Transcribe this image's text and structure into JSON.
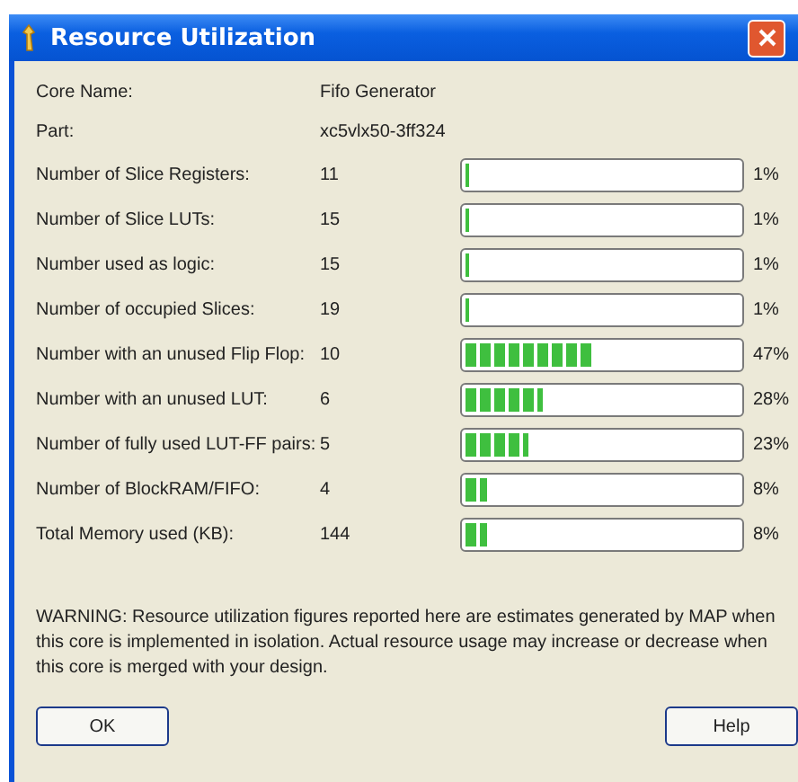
{
  "window": {
    "title": "Resource Utilization"
  },
  "info": [
    {
      "label": "Core Name:",
      "value": "Fifo Generator"
    },
    {
      "label": "Part:",
      "value": "xc5vlx50-3ff324"
    }
  ],
  "resources": [
    {
      "label": "Number of Slice Registers:",
      "value": "11",
      "level": 0.01,
      "percent": "1%"
    },
    {
      "label": "Number of Slice LUTs:",
      "value": "15",
      "level": 0.01,
      "percent": "1%"
    },
    {
      "label": "Number used as logic:",
      "value": "15",
      "level": 0.01,
      "percent": "1%"
    },
    {
      "label": "Number of occupied Slices:",
      "value": "19",
      "level": 0.01,
      "percent": "1%"
    },
    {
      "label": "Number with an unused Flip Flop:",
      "value": "10",
      "level": 0.47,
      "percent": "47%"
    },
    {
      "label": "Number with an unused LUT:",
      "value": "6",
      "level": 0.28,
      "percent": "28%"
    },
    {
      "label": "Number of fully used LUT-FF pairs:",
      "value": "5",
      "level": 0.23,
      "percent": "23%"
    },
    {
      "label": "Number of BlockRAM/FIFO:",
      "value": "4",
      "level": 0.08,
      "percent": "8%"
    },
    {
      "label": "Total Memory used (KB):",
      "value": "144",
      "level": 0.08,
      "percent": "8%"
    }
  ],
  "warning": "WARNING: Resource utilization figures reported here are estimates generated by MAP when this core is implemented in isolation.  Actual resource usage may increase or decrease when this core is merged with your design.",
  "buttons": [
    {
      "label": "OK"
    },
    {
      "label": "Help"
    }
  ]
}
